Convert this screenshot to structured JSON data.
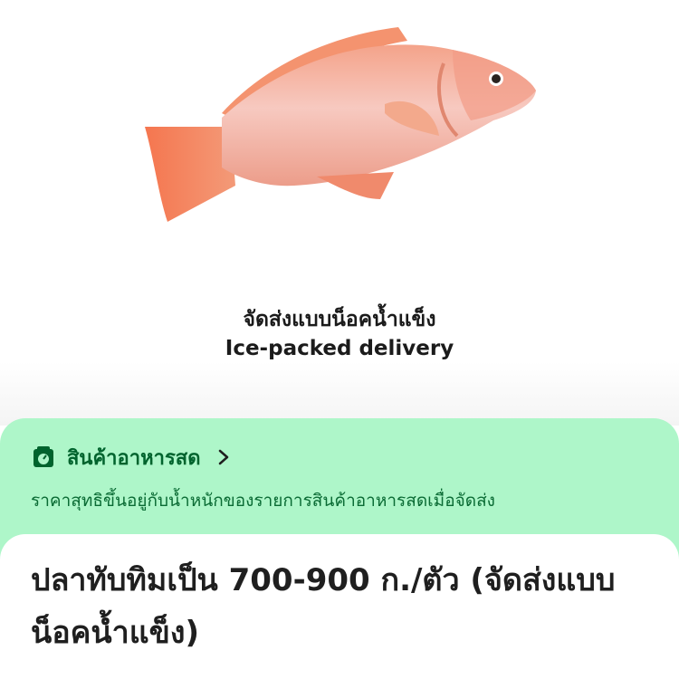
{
  "hero": {
    "image_icon": "fish-photo",
    "caption_th": "จัดส่งแบบน็อคน้ำแข็ง",
    "caption_en": "Ice-packed delivery"
  },
  "fresh_banner": {
    "icon": "scale-icon",
    "title": "สินค้าอาหารสด",
    "chevron_icon": "chevron-right-icon",
    "description": "ราคาสุทธิขึ้นอยู่กับน้ำหนักของรายการสินค้าอาหารสดเมื่อจัดส่ง",
    "background_color": "#aef6c9",
    "text_color": "#00632d"
  },
  "product": {
    "title": "ปลาทับทิมเป็น 700-900 ก./ตัว (จัดส่งแบบน็อคน้ำแข็ง)"
  }
}
